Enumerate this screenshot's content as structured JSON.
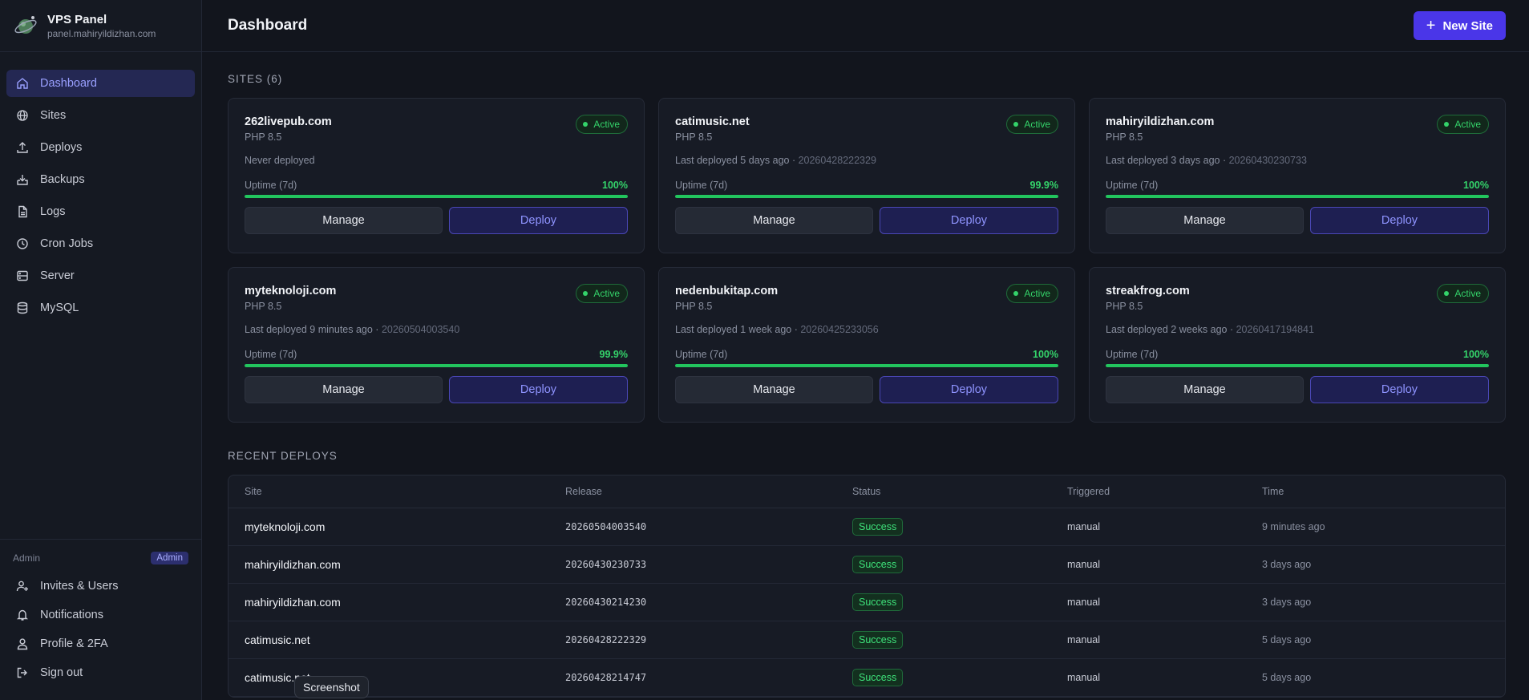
{
  "brand": {
    "title": "VPS Panel",
    "subtitle": "panel.mahiryildizhan.com"
  },
  "nav": [
    {
      "label": "Dashboard",
      "icon": "home-icon",
      "active": true
    },
    {
      "label": "Sites",
      "icon": "globe-icon"
    },
    {
      "label": "Deploys",
      "icon": "upload-icon"
    },
    {
      "label": "Backups",
      "icon": "download-box-icon"
    },
    {
      "label": "Logs",
      "icon": "file-icon"
    },
    {
      "label": "Cron Jobs",
      "icon": "clock-icon"
    },
    {
      "label": "Server",
      "icon": "server-icon"
    },
    {
      "label": "MySQL",
      "icon": "database-icon"
    }
  ],
  "admin": {
    "label": "Admin",
    "badge": "Admin",
    "items": [
      {
        "label": "Invites & Users",
        "icon": "user-plus-icon"
      },
      {
        "label": "Notifications",
        "icon": "bell-icon"
      },
      {
        "label": "Profile & 2FA",
        "icon": "user-icon"
      },
      {
        "label": "Sign out",
        "icon": "sign-out-icon"
      }
    ]
  },
  "header": {
    "title": "Dashboard",
    "new_site_label": "New Site"
  },
  "sites_section": {
    "title": "SITES (6)"
  },
  "sites": [
    {
      "name": "262livepub.com",
      "php": "PHP 8.5",
      "status": "Active",
      "deploy_text": "Never deployed",
      "release": "",
      "uptime_label": "Uptime (7d)",
      "uptime": "100%",
      "uptime_pct": 100,
      "manage": "Manage",
      "deploy": "Deploy"
    },
    {
      "name": "catimusic.net",
      "php": "PHP 8.5",
      "status": "Active",
      "deploy_text": "Last deployed 5 days ago · ",
      "release": "20260428222329",
      "uptime_label": "Uptime (7d)",
      "uptime": "99.9%",
      "uptime_pct": 99.9,
      "manage": "Manage",
      "deploy": "Deploy"
    },
    {
      "name": "mahiryildizhan.com",
      "php": "PHP 8.5",
      "status": "Active",
      "deploy_text": "Last deployed 3 days ago · ",
      "release": "20260430230733",
      "uptime_label": "Uptime (7d)",
      "uptime": "100%",
      "uptime_pct": 100,
      "manage": "Manage",
      "deploy": "Deploy"
    },
    {
      "name": "myteknoloji.com",
      "php": "PHP 8.5",
      "status": "Active",
      "deploy_text": "Last deployed 9 minutes ago · ",
      "release": "20260504003540",
      "uptime_label": "Uptime (7d)",
      "uptime": "99.9%",
      "uptime_pct": 99.9,
      "manage": "Manage",
      "deploy": "Deploy"
    },
    {
      "name": "nedenbukitap.com",
      "php": "PHP 8.5",
      "status": "Active",
      "deploy_text": "Last deployed 1 week ago · ",
      "release": "20260425233056",
      "uptime_label": "Uptime (7d)",
      "uptime": "100%",
      "uptime_pct": 100,
      "manage": "Manage",
      "deploy": "Deploy"
    },
    {
      "name": "streakfrog.com",
      "php": "PHP 8.5",
      "status": "Active",
      "deploy_text": "Last deployed 2 weeks ago · ",
      "release": "20260417194841",
      "uptime_label": "Uptime (7d)",
      "uptime": "100%",
      "uptime_pct": 100,
      "manage": "Manage",
      "deploy": "Deploy"
    }
  ],
  "deploys_section": {
    "title": "RECENT DEPLOYS"
  },
  "deploys_table": {
    "columns": [
      "Site",
      "Release",
      "Status",
      "Triggered",
      "Time"
    ],
    "rows": [
      {
        "site": "myteknoloji.com",
        "release": "20260504003540",
        "status": "Success",
        "triggered": "manual",
        "time": "9 minutes ago"
      },
      {
        "site": "mahiryildizhan.com",
        "release": "20260430230733",
        "status": "Success",
        "triggered": "manual",
        "time": "3 days ago"
      },
      {
        "site": "mahiryildizhan.com",
        "release": "20260430214230",
        "status": "Success",
        "triggered": "manual",
        "time": "3 days ago"
      },
      {
        "site": "catimusic.net",
        "release": "20260428222329",
        "status": "Success",
        "triggered": "manual",
        "time": "5 days ago"
      },
      {
        "site": "catimusic.net",
        "release": "20260428214747",
        "status": "Success",
        "triggered": "manual",
        "time": "5 days ago"
      }
    ]
  },
  "tooltip": "Screenshot",
  "colors": {
    "accent": "#4a36e8",
    "success": "#22c55e",
    "background": "#12151d"
  }
}
